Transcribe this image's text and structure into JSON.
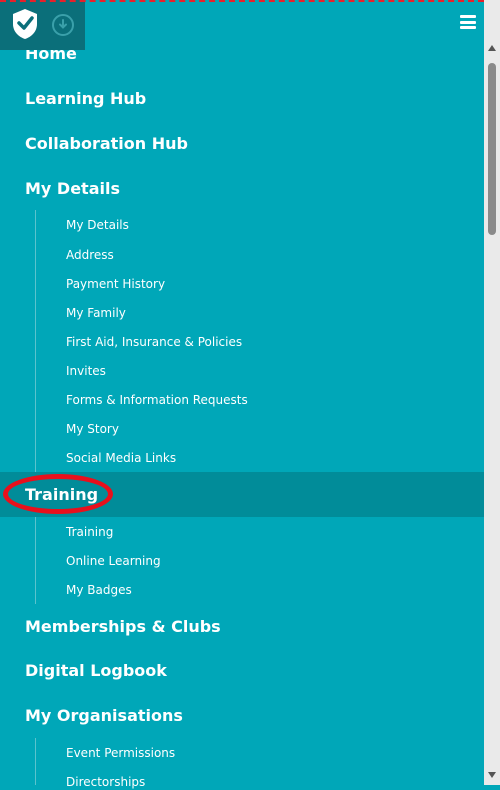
{
  "header": {
    "logo_icon": "shield-badge-icon",
    "download_icon": "download-circle-icon",
    "menu_icon": "hamburger-menu-icon"
  },
  "nav": {
    "home": "Home",
    "learning_hub": "Learning Hub",
    "collaboration_hub": "Collaboration Hub",
    "my_details": {
      "label": "My Details",
      "items": [
        "My Details",
        "Address",
        "Payment History",
        "My Family",
        "First Aid, Insurance & Policies",
        "Invites",
        "Forms & Information Requests",
        "My Story",
        "Social Media Links"
      ]
    },
    "training": {
      "label": "Training",
      "items": [
        "Training",
        "Online Learning",
        "My Badges"
      ]
    },
    "memberships_clubs": "Memberships & Clubs",
    "digital_logbook": "Digital Logbook",
    "my_organisations": {
      "label": "My Organisations",
      "items": [
        "Event Permissions",
        "Directorships"
      ]
    }
  },
  "colors": {
    "background": "#00a7b8",
    "active_row": "#018c99",
    "highlight_ring": "#e8101c"
  }
}
